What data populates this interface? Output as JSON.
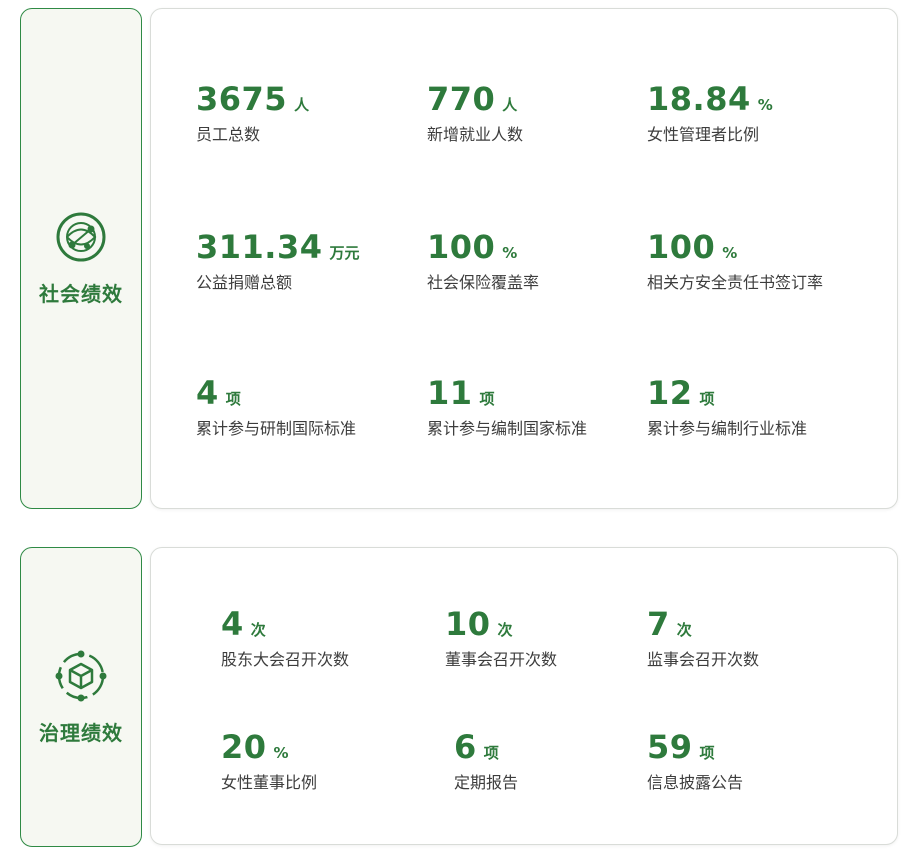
{
  "social": {
    "title": "社会绩效",
    "icon": "globe-network-icon",
    "stats": [
      {
        "value": "3675",
        "unit": "人",
        "label": "员工总数"
      },
      {
        "value": "770",
        "unit": "人",
        "label": "新增就业人数"
      },
      {
        "value": "18.84",
        "unit": "%",
        "label": "女性管理者比例"
      },
      {
        "value": "311.34",
        "unit": "万元",
        "label": "公益捐赠总额"
      },
      {
        "value": "100",
        "unit": "%",
        "label": "社会保险覆盖率"
      },
      {
        "value": "100",
        "unit": "%",
        "label": "相关方安全责任书签订率"
      },
      {
        "value": "4",
        "unit": "项",
        "label": "累计参与研制国际标准"
      },
      {
        "value": "11",
        "unit": "项",
        "label": "累计参与编制国家标准"
      },
      {
        "value": "12",
        "unit": "项",
        "label": "累计参与编制行业标准"
      }
    ]
  },
  "governance": {
    "title": "治理绩效",
    "icon": "cube-network-icon",
    "stats": [
      {
        "value": "4",
        "unit": "次",
        "label": "股东大会召开次数"
      },
      {
        "value": "10",
        "unit": "次",
        "label": "董事会召开次数"
      },
      {
        "value": "7",
        "unit": "次",
        "label": "监事会召开次数"
      },
      {
        "value": "20",
        "unit": "%",
        "label": "女性董事比例"
      },
      {
        "value": "6",
        "unit": "项",
        "label": "定期报告"
      },
      {
        "value": "59",
        "unit": "项",
        "label": "信息披露公告"
      }
    ]
  },
  "colors": {
    "accent": "#2e7a3c",
    "side_bg": "#f6f8f2",
    "border": "#2f8a45",
    "label": "#3d3d3d"
  }
}
